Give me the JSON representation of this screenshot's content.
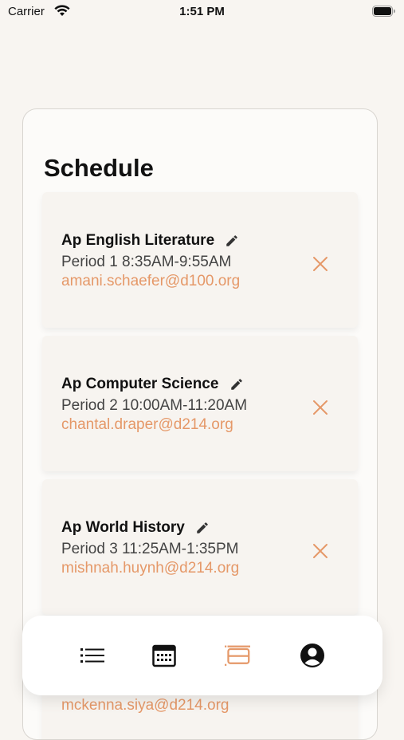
{
  "status_bar": {
    "carrier": "Carrier",
    "time": "1:51 PM"
  },
  "schedule": {
    "title": "Schedule",
    "classes": [
      {
        "name": "Ap English Literature",
        "period": "Period 1 8:35AM-9:55AM",
        "email": "amani.schaefer@d100.org"
      },
      {
        "name": "Ap Computer Science",
        "period": "Period 2 10:00AM-11:20AM",
        "email": "chantal.draper@d214.org"
      },
      {
        "name": "Ap World History",
        "period": "Period 3 11:25AM-1:35PM",
        "email": "mishnah.huynh@d214.org"
      },
      {
        "email": "mckenna.siya@d214.org"
      }
    ]
  },
  "tab_bar": {
    "items": [
      {
        "icon": "list-icon"
      },
      {
        "icon": "calendar-icon"
      },
      {
        "icon": "schedule-icon",
        "active": true
      },
      {
        "icon": "profile-icon"
      }
    ]
  },
  "colors": {
    "accent": "#e59868",
    "background": "#f8f5f1",
    "card": "#f7f4f0"
  }
}
